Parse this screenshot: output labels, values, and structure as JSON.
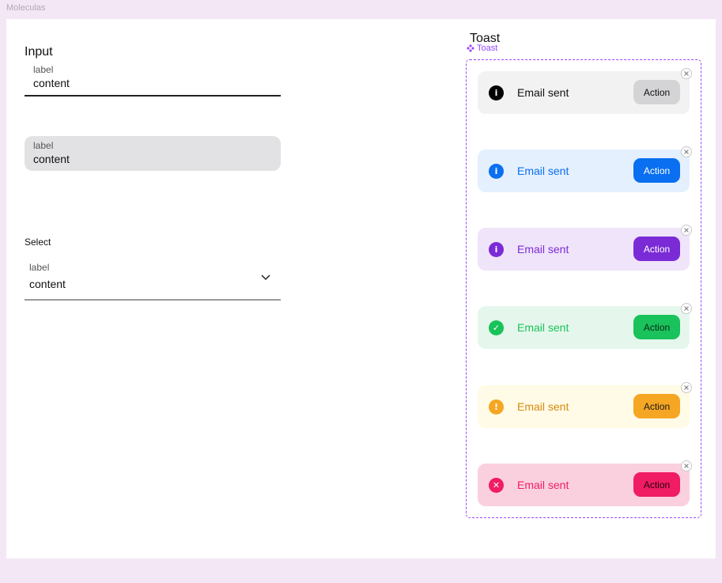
{
  "page": {
    "label": "Moleculas"
  },
  "input_section": {
    "title": "Input",
    "underlined_field": {
      "label": "label",
      "value": "content"
    },
    "filled_field": {
      "label": "label",
      "value": "content"
    }
  },
  "select_section": {
    "title": "Select",
    "field": {
      "label": "label",
      "value": "content",
      "icon": "chevron-down-icon"
    }
  },
  "toast_section": {
    "title": "Toast",
    "component_tag": "Toast",
    "toasts": [
      {
        "variant": "neutral",
        "icon": "info-icon",
        "text": "Email sent",
        "action": "Action",
        "bg": "#f2f2f2",
        "icon_color": "#000000",
        "text_color": "#111111",
        "button_bg": "#d4d4d6",
        "button_text": "#111111"
      },
      {
        "variant": "info",
        "icon": "info-icon",
        "text": "Email sent",
        "action": "Action",
        "bg": "#e4f0fe",
        "icon_color": "#0a6ff0",
        "text_color": "#0a6ff0",
        "button_bg": "#0a6ff0",
        "button_text": "#ffffff"
      },
      {
        "variant": "brand",
        "icon": "info-icon",
        "text": "Email sent",
        "action": "Action",
        "bg": "#efe4fa",
        "icon_color": "#7b2bd6",
        "text_color": "#7b2bd6",
        "button_bg": "#7b2bd6",
        "button_text": "#ffffff"
      },
      {
        "variant": "success",
        "icon": "check-circle-icon",
        "text": "Email sent",
        "action": "Action",
        "bg": "#e5f7ec",
        "icon_color": "#19c25a",
        "text_color": "#19c25a",
        "button_bg": "#19c25a",
        "button_text": "#0d2a18"
      },
      {
        "variant": "warning",
        "icon": "alert-icon",
        "text": "Email sent",
        "action": "Action",
        "bg": "#fffbe6",
        "icon_color": "#f5a623",
        "text_color": "#d68a10",
        "button_bg": "#f5a623",
        "button_text": "#1a1a1a"
      },
      {
        "variant": "error",
        "icon": "error-icon",
        "text": "Email sent",
        "action": "Action",
        "bg": "#fbd0de",
        "icon_color": "#f01c64",
        "text_color": "#f01c64",
        "button_bg": "#f01c64",
        "button_text": "#2a0010"
      }
    ]
  }
}
